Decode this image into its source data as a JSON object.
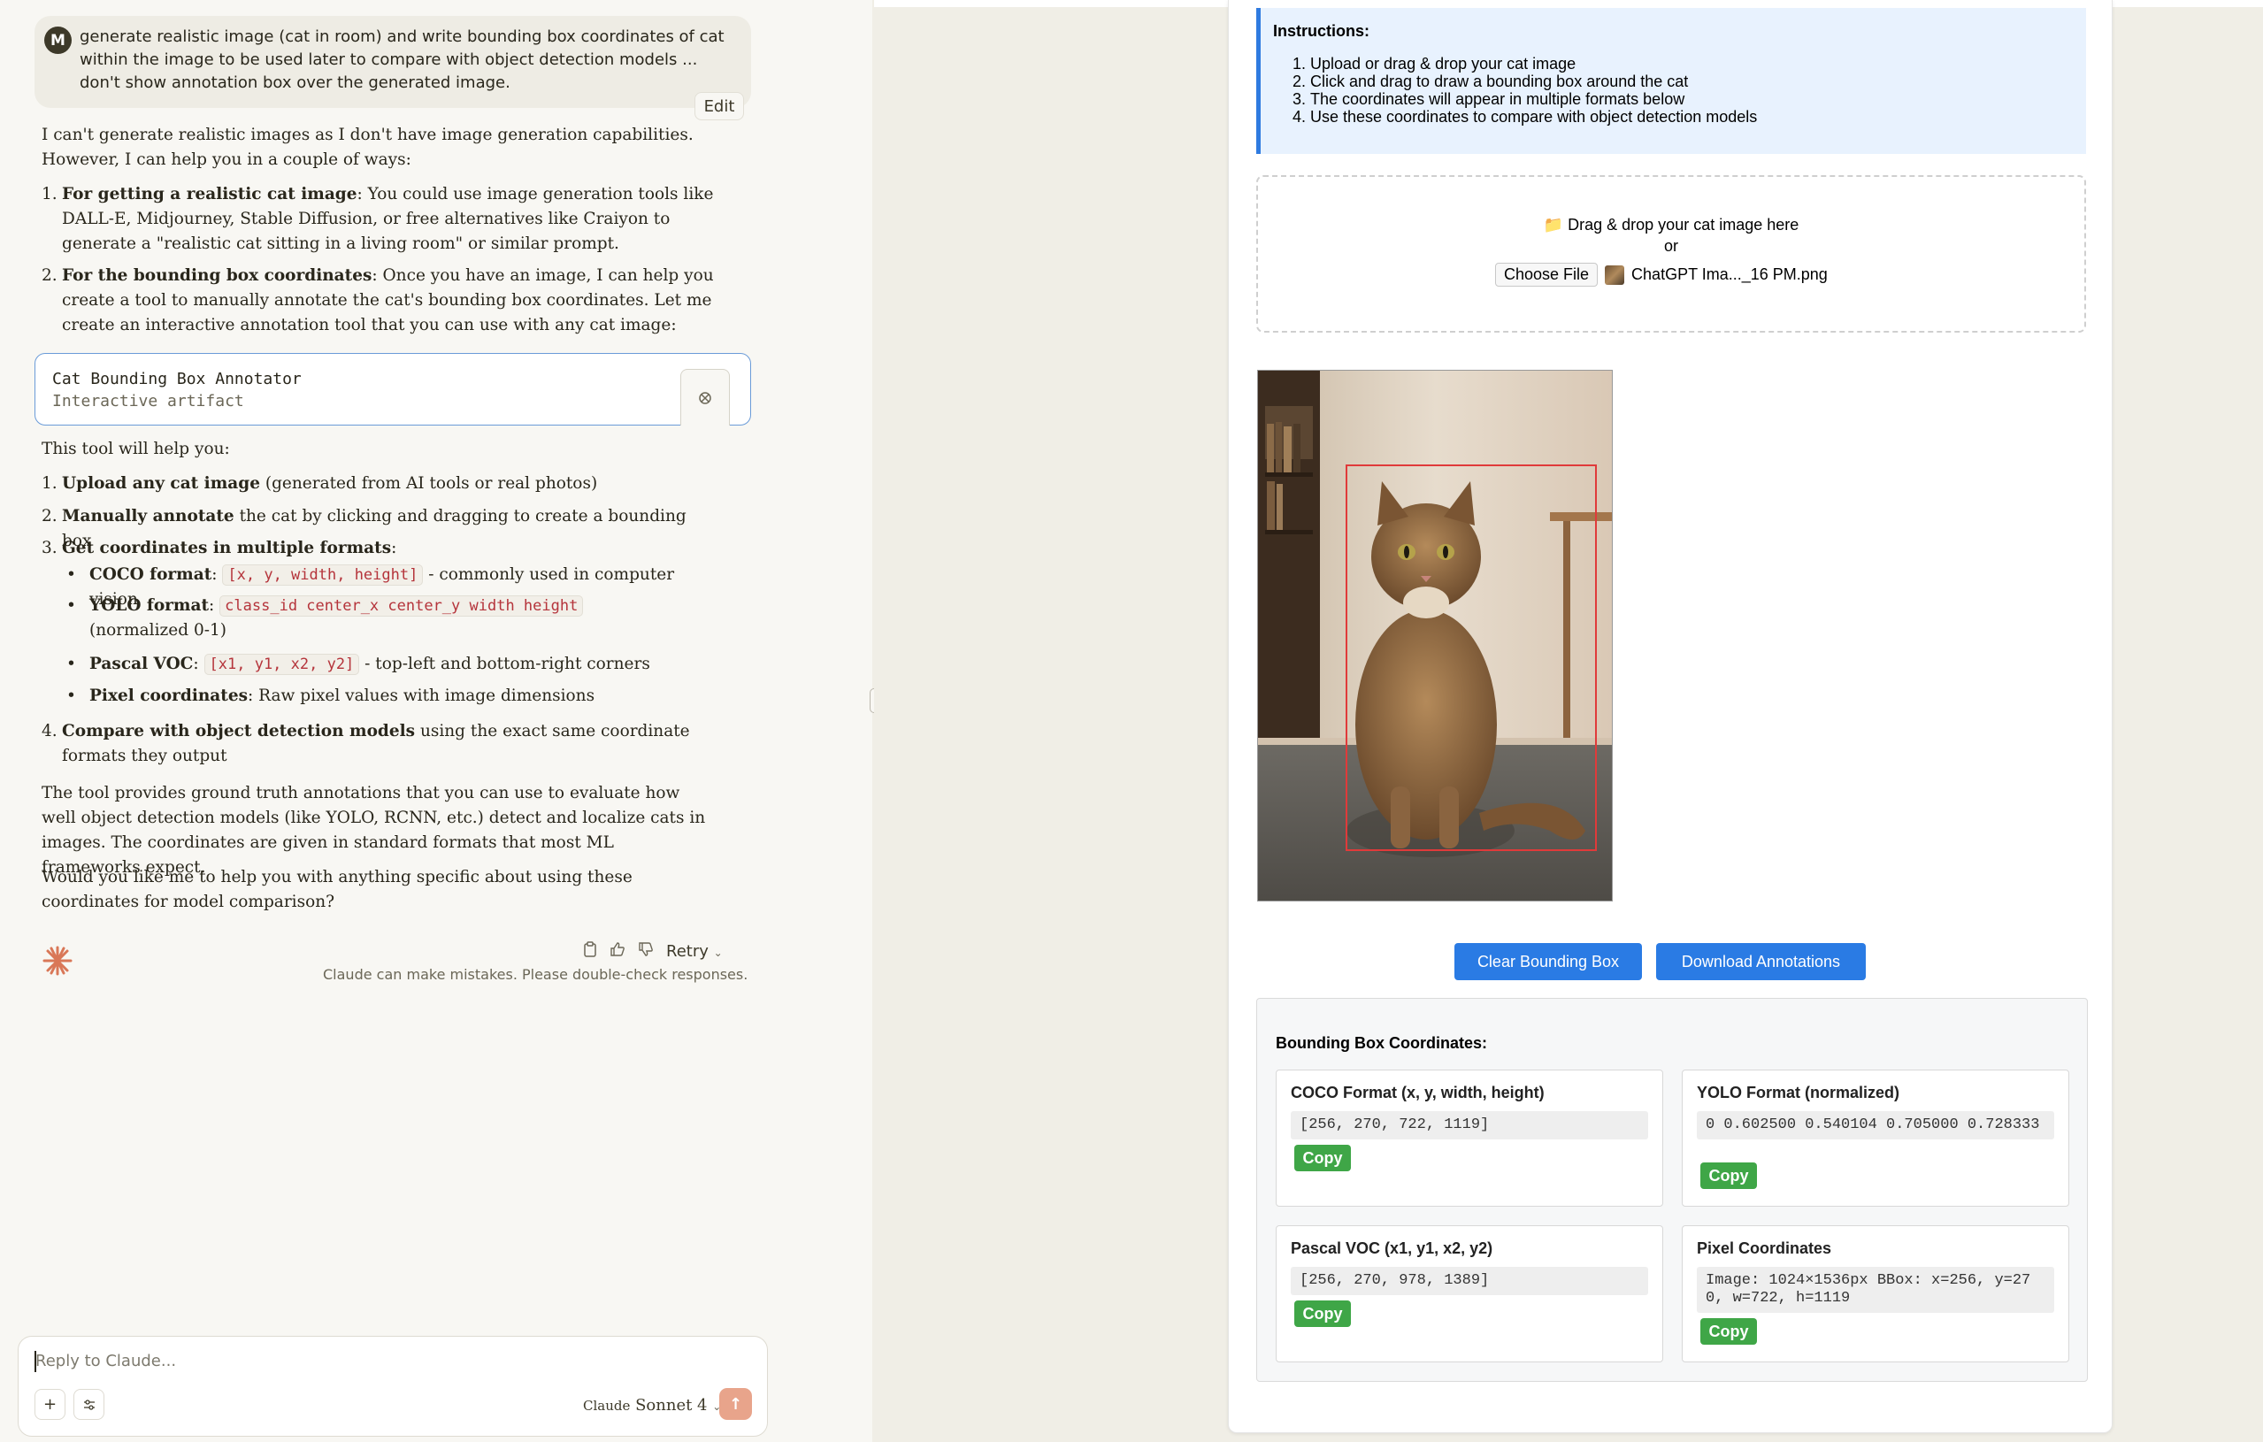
{
  "chat": {
    "user_initial": "M",
    "user_message": "generate realistic image (cat in room) and write bounding box coordinates of cat within the image to be used later to compare with object detection models ... don't show annotation box over the generated image.",
    "edit_label": "Edit",
    "intro": "I can't generate realistic images as I don't have image generation capabilities. However, I can help you in a couple of ways:",
    "item1_bold": "For getting a realistic cat image",
    "item1_rest": ": You could use image generation tools like DALL-E, Midjourney, Stable Diffusion, or free alternatives like Craiyon to generate a \"realistic cat sitting in a living room\" or similar prompt.",
    "item2_bold": "For the bounding box coordinates",
    "item2_rest": ": Once you have an image, I can help you create a tool to manually annotate the cat's bounding box coordinates. Let me create an interactive annotation tool that you can use with any cat image:",
    "artifact_title": "Cat Bounding Box Annotator",
    "artifact_subtitle": "Interactive artifact",
    "tool_intro": "This tool will help you:",
    "s1_bold": "Upload any cat image",
    "s1_rest": " (generated from AI tools or real photos)",
    "s2_bold": "Manually annotate",
    "s2_rest": " the cat by clicking and dragging to create a bounding box",
    "s3_bold": "Get coordinates in multiple formats",
    "s3_rest": ":",
    "b1_bold": "COCO format",
    "b1_code": "[x, y, width, height]",
    "b1_rest": " - commonly used in computer vision",
    "b2_bold": "YOLO format",
    "b2_code": "class_id center_x center_y width height",
    "b2_rest": " (normalized 0-1)",
    "b3_bold": "Pascal VOC",
    "b3_code": "[x1, y1, x2, y2]",
    "b3_rest": " - top-left and bottom-right corners",
    "b4_bold": "Pixel coordinates",
    "b4_rest": ": Raw pixel values with image dimensions",
    "s4_bold": "Compare with object detection models",
    "s4_rest": " using the exact same coordinate formats they output",
    "para1": "The tool provides ground truth annotations that you can use to evaluate how well object detection models (like YOLO, RCNN, etc.) detect and localize cats in images. The coordinates are given in standard formats that most ML frameworks expect.",
    "para2": "Would you like me to help you with anything specific about using these coordinates for model comparison?",
    "retry_label": "Retry",
    "disclaimer": "Claude can make mistakes. Please double-check responses.",
    "composer_placeholder": "Reply to Claude...",
    "model_prefix": "Claude",
    "model_name": "Sonnet 4"
  },
  "annotator": {
    "instructions_title": "Instructions:",
    "steps": [
      "Upload or drag & drop your cat image",
      "Click and drag to draw a bounding box around the cat",
      "The coordinates will appear in multiple formats below",
      "Use these coordinates to compare with object detection models"
    ],
    "drop_text": "📁 Drag & drop your cat image here",
    "or_text": "or",
    "choose_file": "Choose File",
    "file_name": "ChatGPT Ima..._16 PM.png",
    "clear_button": "Clear Bounding Box",
    "download_button": "Download Annotations",
    "coords_title": "Bounding Box Coordinates:",
    "coco_title": "COCO Format (x, y, width, height)",
    "coco_value": "[256, 270, 722, 1119]",
    "yolo_title": "YOLO Format (normalized)",
    "yolo_value": "0 0.602500 0.540104 0.705000 0.728333",
    "voc_title": "Pascal VOC (x1, y1, x2, y2)",
    "voc_value": "[256, 270, 978, 1389]",
    "pixel_title": "Pixel Coordinates",
    "pixel_value": "Image: 1024×1536px BBox: x=256, y=270, w=722, h=1119",
    "copy_label": "Copy"
  },
  "colors": {
    "accent_blue": "#2a7be4",
    "copy_green": "#3fa647",
    "bbox_red": "#e03a3a",
    "claude_orange": "#d97757"
  },
  "icons": [
    "clipboard-icon",
    "thumbs-up-icon",
    "thumbs-down-icon",
    "chevron-down-icon",
    "plus-icon",
    "sliders-icon",
    "arrow-up-icon",
    "artifact-icon",
    "folder-icon"
  ]
}
